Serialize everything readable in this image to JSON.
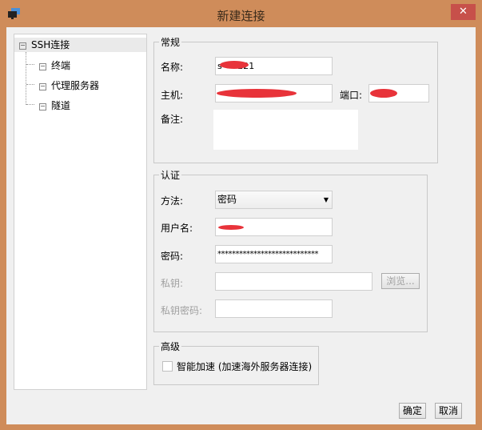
{
  "window": {
    "title": "新建连接",
    "close_label": "✕"
  },
  "tree": {
    "items": [
      {
        "label": "SSH连接"
      },
      {
        "label": "终端"
      },
      {
        "label": "代理服务器"
      },
      {
        "label": "隧道"
      }
    ]
  },
  "general": {
    "legend": "常规",
    "name_label": "名称:",
    "name_value": "s•••221",
    "host_label": "主机:",
    "port_label": "端口:",
    "note_label": "备注:"
  },
  "auth": {
    "legend": "认证",
    "method_label": "方法:",
    "method_value": "密码",
    "user_label": "用户名:",
    "password_label": "密码:",
    "password_value": "****************************",
    "key_label": "私钥:",
    "browse_label": "浏览...",
    "key_pass_label": "私钥密码:"
  },
  "advanced": {
    "legend": "高级",
    "accel_label": "智能加速 (加速海外服务器连接)",
    "accel_checked": false
  },
  "buttons": {
    "ok": "确定",
    "cancel": "取消"
  }
}
